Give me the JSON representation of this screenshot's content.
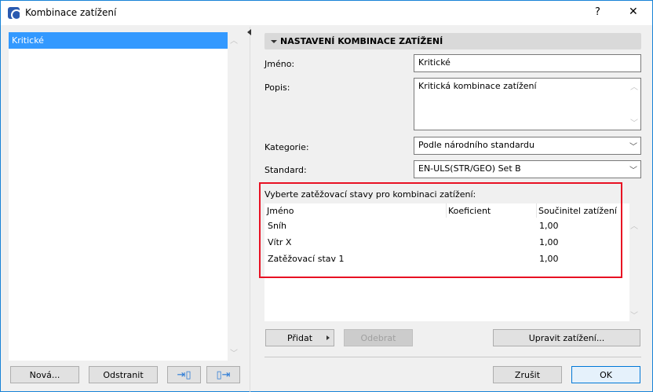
{
  "window": {
    "title": "Kombinace zatížení",
    "help": "?",
    "close": "✕"
  },
  "left": {
    "items": [
      {
        "label": "Kritické",
        "selected": true
      }
    ],
    "buttons": {
      "new": "Nová...",
      "remove": "Odstranit"
    }
  },
  "panel": {
    "header": "NASTAVENÍ KOMBINACE ZATÍŽENÍ",
    "name_label": "Jméno:",
    "name_value": "Kritické",
    "desc_label": "Popis:",
    "desc_value": "Kritická kombinace zatížení",
    "category_label": "Kategorie:",
    "category_value": "Podle národního standardu",
    "standard_label": "Standard:",
    "standard_value": "EN-ULS(STR/GEO) Set B",
    "cases_label": "Vyberte zatěžovací stavy pro kombinaci zatížení:",
    "columns": [
      "Jméno",
      "Koeficient",
      "Součinitel zatížení"
    ],
    "rows": [
      {
        "name": "Sníh",
        "coef": "",
        "factor": "1,00"
      },
      {
        "name": "Vítr X",
        "coef": "",
        "factor": "1,00"
      },
      {
        "name": "Zatěžovací stav 1",
        "coef": "",
        "factor": "1,00"
      }
    ],
    "add": "Přidat",
    "remove": "Odebrat",
    "edit_loads": "Upravit zatížení..."
  },
  "footer": {
    "cancel": "Zrušit",
    "ok": "OK"
  },
  "colors": {
    "accent": "#3399ff",
    "highlight": "#e81123"
  }
}
